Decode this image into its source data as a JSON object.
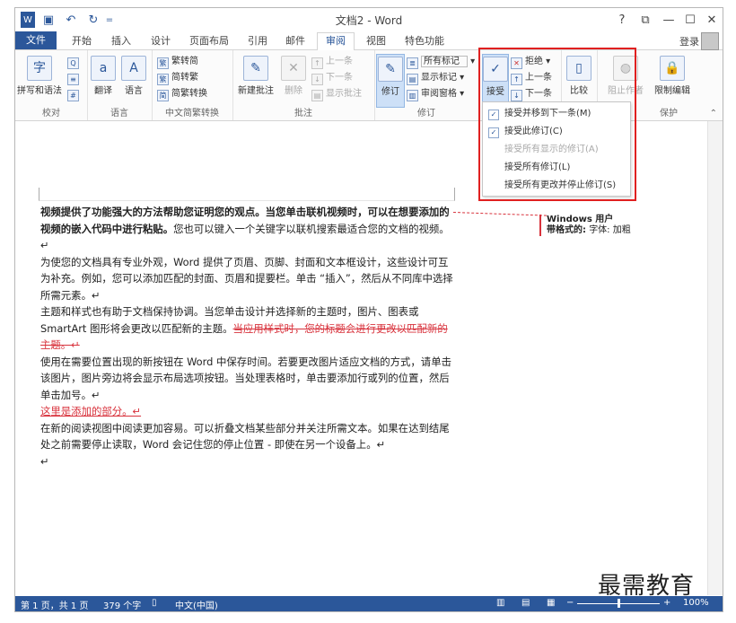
{
  "window": {
    "title": "文档2 - Word",
    "help": "?",
    "restore": "⧉",
    "minimize": "—",
    "maximize": "☐",
    "close": "✕"
  },
  "quick_access": {
    "save": "💾",
    "undo": "↶",
    "redo": "↻",
    "customize": "="
  },
  "tabs": [
    {
      "label": "文件"
    },
    {
      "label": "开始"
    },
    {
      "label": "插入"
    },
    {
      "label": "设计"
    },
    {
      "label": "页面布局"
    },
    {
      "label": "引用"
    },
    {
      "label": "邮件"
    },
    {
      "label": "审阅"
    },
    {
      "label": "视图"
    },
    {
      "label": "特色功能"
    }
  ],
  "login": "登录",
  "ribbon": {
    "proofing": {
      "spell": "拼写和语法",
      "label": "校对"
    },
    "language": {
      "translate": "翻译",
      "language": "语言",
      "label": "语言"
    },
    "chinese": {
      "to_trad": "繁转简",
      "to_simp": "简转繁",
      "convert": "简繁转换",
      "label": "中文简繁转换"
    },
    "comments": {
      "new": "新建批注",
      "delete": "删除",
      "prev": "上一条",
      "next": "下一条",
      "show": "显示批注",
      "label": "批注"
    },
    "tracking": {
      "track": "修订",
      "all_markup": "所有标记",
      "show_markup": "显示标记",
      "pane": "审阅窗格",
      "label": "修订"
    },
    "changes": {
      "accept": "接受",
      "reject": "拒绝",
      "prev": "上一条",
      "next": "下一条"
    },
    "compare": {
      "compare": "比较"
    },
    "protect": {
      "block": "阻止作者",
      "restrict": "限制编辑",
      "label": "保护"
    }
  },
  "accept_menu": [
    {
      "label": "接受并移到下一条(M)",
      "enabled": true
    },
    {
      "label": "接受此修订(C)",
      "enabled": true
    },
    {
      "label": "接受所有显示的修订(A)",
      "enabled": false
    },
    {
      "label": "接受所有修订(L)",
      "enabled": true
    },
    {
      "label": "接受所有更改并停止修订(S)",
      "enabled": true
    }
  ],
  "document": {
    "p1": "视频提供了功能强大的方法帮助您证明您的观点。当您单击联机视频时，可以在想要添加的视频的嵌入代码中进行粘贴。",
    "p1b": "您也可以键入一个关键字以联机搜索最适合您的文档的视频。↵",
    "p2": "为使您的文档具有专业外观，Word 提供了页眉、页脚、封面和文本框设计，这些设计可互为补充。例如，您可以添加匹配的封面、页眉和提要栏。单击 “插入”，然后从不同库中选择所需元素。↵",
    "p3": "主题和样式也有助于文档保持协调。当您单击设计并选择新的主题时，图片、图表或 SmartArt 图形将会更改以匹配新的主题。",
    "p3_deleted": "当应用样式时，您的标题会进行更改以匹配新的主题。↵",
    "p4": "使用在需要位置出现的新按钮在 Word 中保存时间。若要更改图片适应文档的方式，请单击该图片，图片旁边将会显示布局选项按钮。当处理表格时，单击要添加行或列的位置，然后单击加号。↵",
    "p5_inserted": "这里是添加的部分。↵",
    "p6": "在新的阅读视图中阅读更加容易。可以折叠文档某些部分并关注所需文本。如果在达到结尾处之前需要停止读取，Word 会记住您的停止位置 - 即使在另一个设备上。↵",
    "p7": "↵"
  },
  "comment": {
    "author": "Windows 用户",
    "label": "带格式的:",
    "detail": "字体: 加粗"
  },
  "status": {
    "page": "第 1 页，共 1 页",
    "words": "379 个字",
    "lang": "中文(中国)",
    "zoom": "100%",
    "zoom_minus": "−",
    "zoom_plus": "+",
    "zoom_level": 0.5
  },
  "watermark": "最需教育",
  "colors": {
    "brand": "#2b579a",
    "revision": "#d8323c",
    "highlight_box": "#e02020"
  }
}
